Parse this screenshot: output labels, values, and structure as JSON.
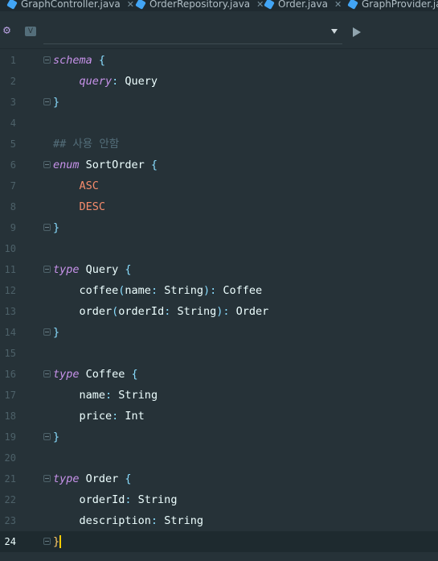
{
  "tabs": [
    {
      "label": "GraphController.java",
      "active": false
    },
    {
      "label": "OrderRepository.java",
      "active": false
    },
    {
      "label": "Order.java",
      "active": false
    },
    {
      "label": "GraphProvider.java",
      "active": false
    }
  ],
  "toolbar": {
    "gear_icon": "gear-icon",
    "v_badge": "V",
    "run_icon": "play-icon"
  },
  "editor": {
    "current_line": 24,
    "lines": [
      {
        "n": "1",
        "tokens": [
          [
            "kw",
            "schema"
          ],
          [
            "ty",
            " "
          ],
          [
            "br",
            "{"
          ]
        ]
      },
      {
        "n": "2",
        "tokens": [
          [
            "ty",
            "    "
          ],
          [
            "qk",
            "query"
          ],
          [
            "pn",
            ":"
          ],
          [
            "ty",
            " Query"
          ]
        ]
      },
      {
        "n": "3",
        "tokens": [
          [
            "br",
            "}"
          ]
        ]
      },
      {
        "n": "4",
        "tokens": []
      },
      {
        "n": "5",
        "tokens": [
          [
            "cm",
            "## 사용 안함"
          ]
        ]
      },
      {
        "n": "6",
        "tokens": [
          [
            "kw",
            "enum"
          ],
          [
            "ty",
            " SortOrder "
          ],
          [
            "br",
            "{"
          ]
        ]
      },
      {
        "n": "7",
        "tokens": [
          [
            "ty",
            "    "
          ],
          [
            "enumv",
            "ASC"
          ]
        ]
      },
      {
        "n": "8",
        "tokens": [
          [
            "ty",
            "    "
          ],
          [
            "enumv",
            "DESC"
          ]
        ]
      },
      {
        "n": "9",
        "tokens": [
          [
            "br",
            "}"
          ]
        ]
      },
      {
        "n": "10",
        "tokens": []
      },
      {
        "n": "11",
        "tokens": [
          [
            "kw",
            "type"
          ],
          [
            "ty",
            " Query "
          ],
          [
            "br",
            "{"
          ]
        ]
      },
      {
        "n": "12",
        "tokens": [
          [
            "ty",
            "    coffee"
          ],
          [
            "pn",
            "("
          ],
          [
            "ty",
            "name"
          ],
          [
            "pn",
            ":"
          ],
          [
            "ty",
            " String"
          ],
          [
            "pn",
            ")"
          ],
          [
            "pn",
            ":"
          ],
          [
            "ty",
            " Coffee"
          ]
        ]
      },
      {
        "n": "13",
        "tokens": [
          [
            "ty",
            "    order"
          ],
          [
            "pn",
            "("
          ],
          [
            "ty",
            "orderId"
          ],
          [
            "pn",
            ":"
          ],
          [
            "ty",
            " String"
          ],
          [
            "pn",
            ")"
          ],
          [
            "pn",
            ":"
          ],
          [
            "ty",
            " Order"
          ]
        ]
      },
      {
        "n": "14",
        "tokens": [
          [
            "br",
            "}"
          ]
        ]
      },
      {
        "n": "15",
        "tokens": []
      },
      {
        "n": "16",
        "tokens": [
          [
            "kw",
            "type"
          ],
          [
            "ty",
            " Coffee "
          ],
          [
            "br",
            "{"
          ]
        ]
      },
      {
        "n": "17",
        "tokens": [
          [
            "ty",
            "    name"
          ],
          [
            "pn",
            ":"
          ],
          [
            "ty",
            " String"
          ]
        ]
      },
      {
        "n": "18",
        "tokens": [
          [
            "ty",
            "    price"
          ],
          [
            "pn",
            ":"
          ],
          [
            "ty",
            " Int"
          ]
        ]
      },
      {
        "n": "19",
        "tokens": [
          [
            "br",
            "}"
          ]
        ]
      },
      {
        "n": "20",
        "tokens": []
      },
      {
        "n": "21",
        "tokens": [
          [
            "kw",
            "type"
          ],
          [
            "ty",
            " Order "
          ],
          [
            "br",
            "{"
          ]
        ]
      },
      {
        "n": "22",
        "tokens": [
          [
            "ty",
            "    orderId"
          ],
          [
            "pn",
            ":"
          ],
          [
            "ty",
            " String"
          ]
        ]
      },
      {
        "n": "23",
        "tokens": [
          [
            "ty",
            "    description"
          ],
          [
            "pn",
            ":"
          ],
          [
            "ty",
            " String"
          ]
        ]
      },
      {
        "n": "24",
        "tokens": [
          [
            "cursor-brace",
            "}"
          ]
        ]
      }
    ],
    "fold_lines": [
      "1",
      "3",
      "6",
      "9",
      "11",
      "14",
      "16",
      "19",
      "21",
      "24"
    ]
  },
  "colors": {
    "background": "#263238",
    "keyword": "#c792ea",
    "enum_value": "#f78c6c",
    "brace": "#89ddff",
    "comment": "#546e7a",
    "caret": "#ffcc00"
  }
}
